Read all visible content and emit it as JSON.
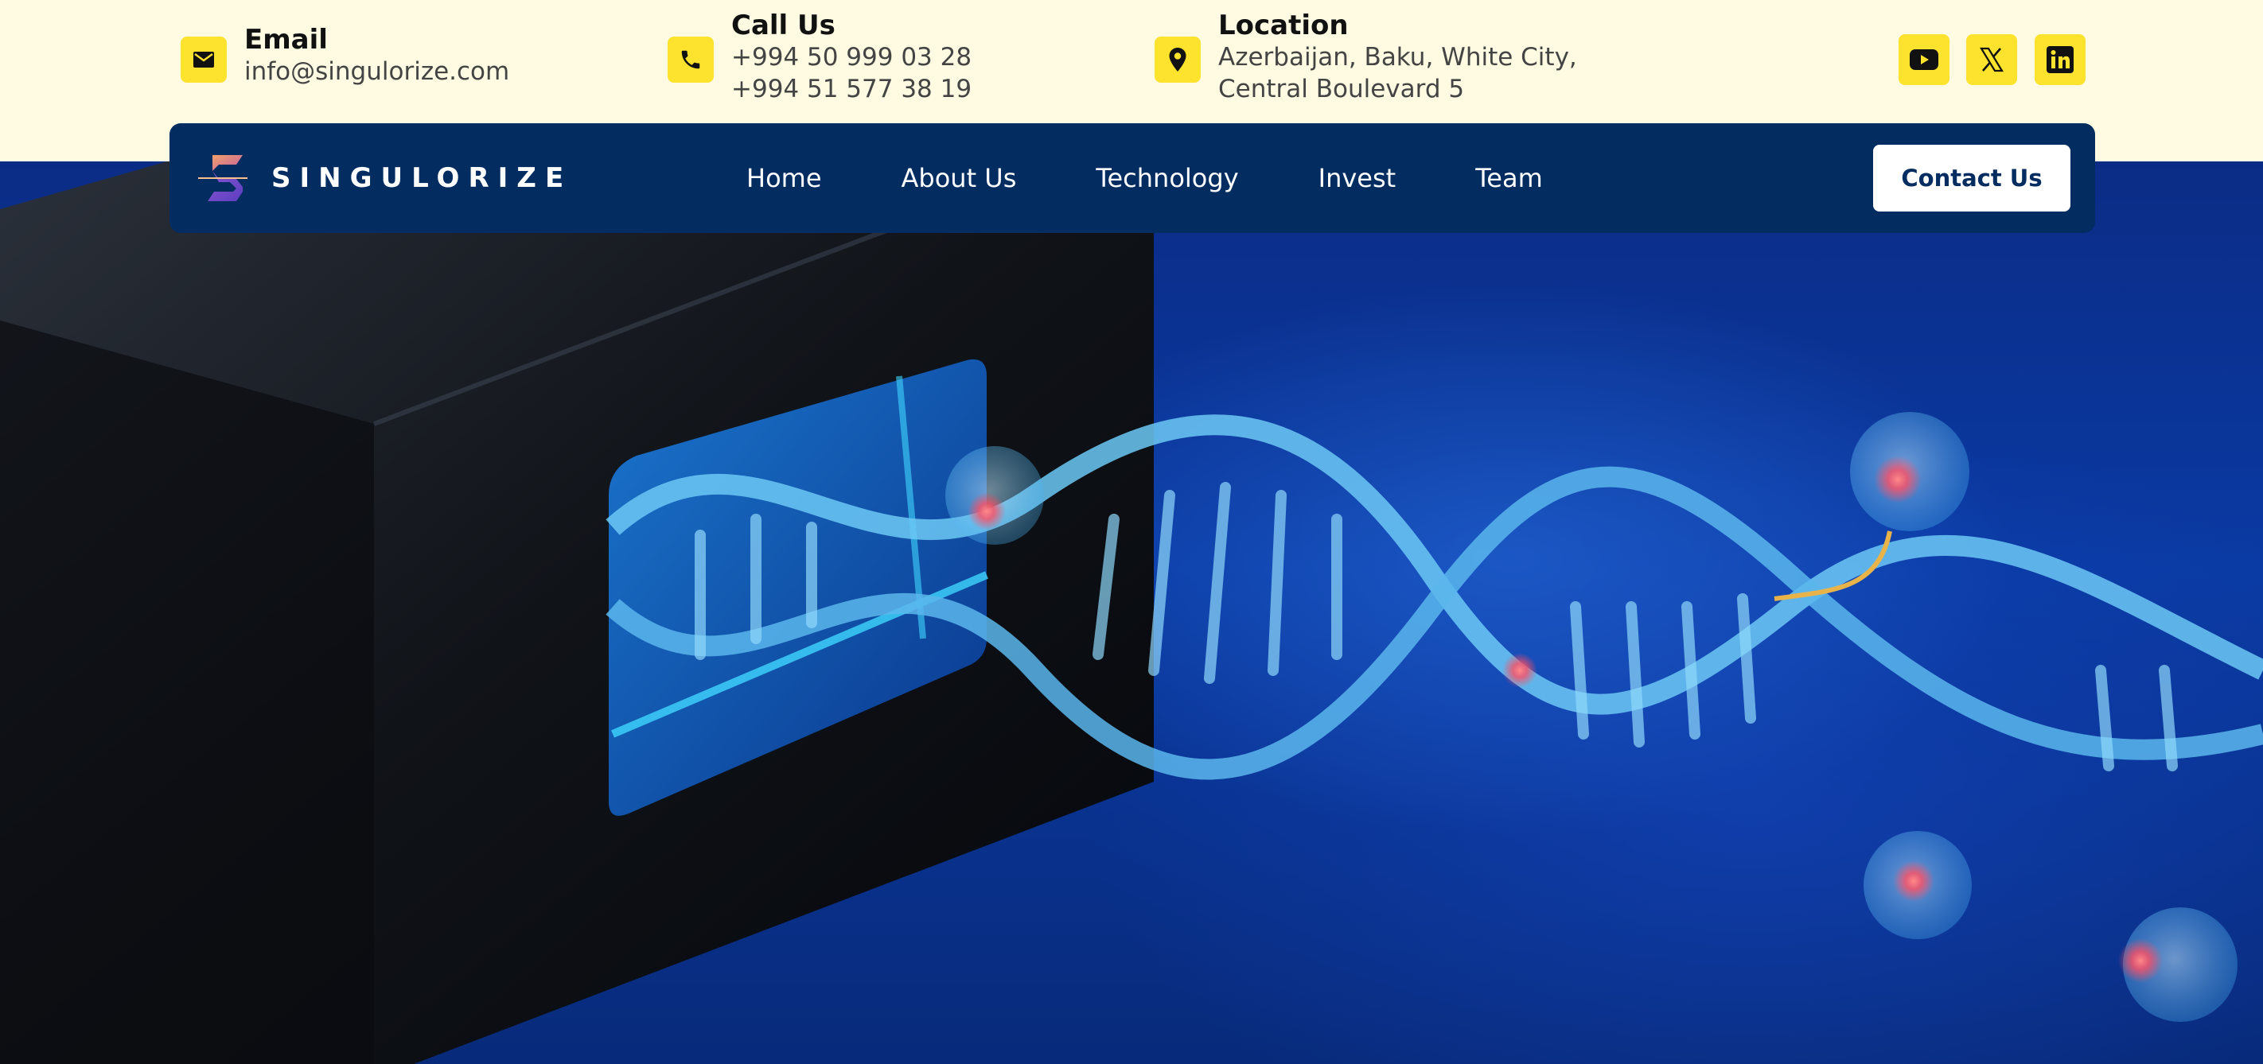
{
  "contacts": {
    "email": {
      "title": "Email",
      "value": "info@singulorize.com",
      "icon": "envelope-icon"
    },
    "call": {
      "title": "Call Us",
      "line1": "+994 50 999 03 28",
      "line2": "+994 51 577 38 19",
      "icon": "phone-icon"
    },
    "location": {
      "title": "Location",
      "line1": "Azerbaijan, Baku, White City,",
      "line2": "Central Boulevard 5",
      "icon": "map-pin-icon"
    }
  },
  "social": [
    {
      "name": "youtube",
      "icon": "youtube-icon"
    },
    {
      "name": "x",
      "icon": "x-icon"
    },
    {
      "name": "linkedin",
      "icon": "linkedin-icon"
    }
  ],
  "nav": {
    "logo_text": "SINGULORIZE",
    "items": [
      "Home",
      "About Us",
      "Technology",
      "Invest",
      "Team"
    ],
    "cta": "Contact Us"
  },
  "hero": {
    "image": "dna-helix-from-device"
  },
  "colors": {
    "topbar_bg": "#fefbe2",
    "accent_yellow": "#fde32d",
    "nav_bg": "#032c60",
    "cta_text": "#032c60"
  }
}
